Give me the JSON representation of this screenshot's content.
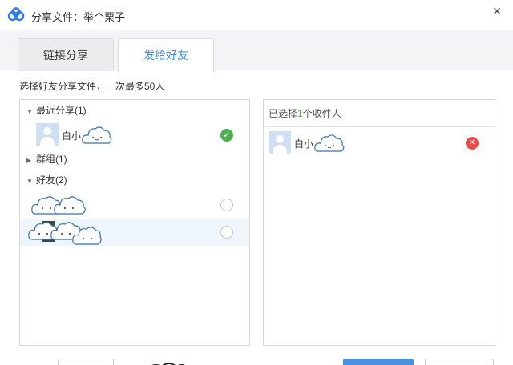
{
  "window": {
    "title": "分享文件：举个栗子",
    "close_glyph": "×"
  },
  "tabs": [
    {
      "label": "链接分享",
      "active": false
    },
    {
      "label": "发给好友",
      "active": true
    }
  ],
  "hint": "选择好友分享文件，一次最多50人",
  "left_panel": {
    "groups": [
      {
        "label": "最近分享(1)",
        "expanded": true
      },
      {
        "label": "群组(1)",
        "expanded": false
      },
      {
        "label": "好友(2)",
        "expanded": true
      }
    ],
    "recent_contact": {
      "name_prefix": "白小",
      "selected": true
    },
    "friends": [
      {
        "selected": false
      },
      {
        "selected": false
      }
    ],
    "expanded_glyph": "▼",
    "collapsed_glyph": "▶",
    "check_glyph": "✓"
  },
  "right_panel": {
    "header_prefix": "已选择",
    "header_count": "1",
    "header_suffix": "个收件人",
    "recipient": {
      "name_prefix": "白小"
    },
    "remove_glyph": "✕"
  },
  "colors": {
    "accent": "#3b8cd9",
    "selected_green": "#4cb050",
    "remove_red": "#ea4a4a",
    "avatar_bg": "#cfe0f4",
    "hover_row": "#eef5fb"
  },
  "icons": {
    "logo": "baidu-netdisk-logo-icon",
    "close": "close-icon",
    "selected": "check-circle-icon",
    "unselected": "empty-circle-icon",
    "remove": "remove-circle-icon",
    "avatar": "default-avatar-icon",
    "redaction": "cloud-sticker-icon"
  }
}
